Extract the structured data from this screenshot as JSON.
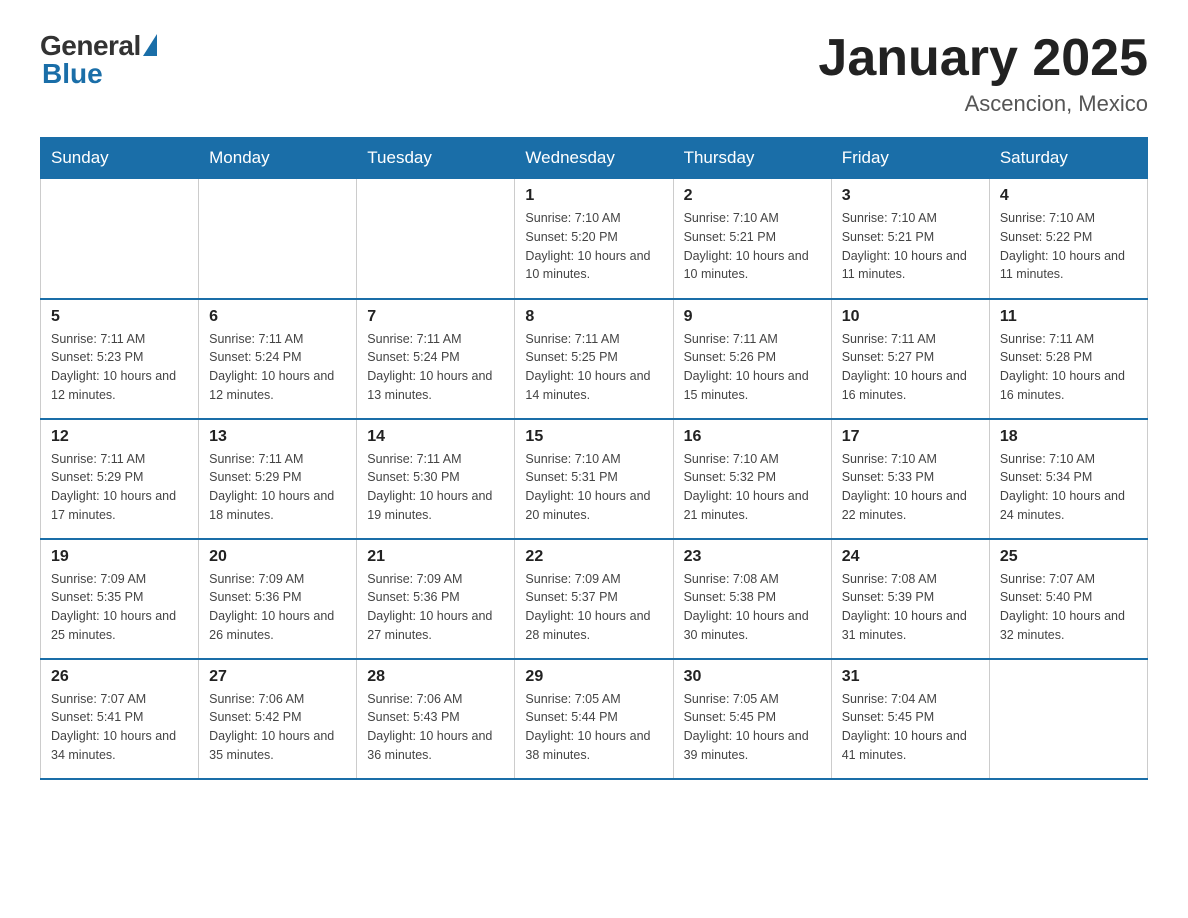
{
  "header": {
    "logo_general": "General",
    "logo_blue": "Blue",
    "month_title": "January 2025",
    "location": "Ascencion, Mexico"
  },
  "days_of_week": [
    "Sunday",
    "Monday",
    "Tuesday",
    "Wednesday",
    "Thursday",
    "Friday",
    "Saturday"
  ],
  "weeks": [
    [
      {
        "day": "",
        "info": ""
      },
      {
        "day": "",
        "info": ""
      },
      {
        "day": "",
        "info": ""
      },
      {
        "day": "1",
        "info": "Sunrise: 7:10 AM\nSunset: 5:20 PM\nDaylight: 10 hours\nand 10 minutes."
      },
      {
        "day": "2",
        "info": "Sunrise: 7:10 AM\nSunset: 5:21 PM\nDaylight: 10 hours\nand 10 minutes."
      },
      {
        "day": "3",
        "info": "Sunrise: 7:10 AM\nSunset: 5:21 PM\nDaylight: 10 hours\nand 11 minutes."
      },
      {
        "day": "4",
        "info": "Sunrise: 7:10 AM\nSunset: 5:22 PM\nDaylight: 10 hours\nand 11 minutes."
      }
    ],
    [
      {
        "day": "5",
        "info": "Sunrise: 7:11 AM\nSunset: 5:23 PM\nDaylight: 10 hours\nand 12 minutes."
      },
      {
        "day": "6",
        "info": "Sunrise: 7:11 AM\nSunset: 5:24 PM\nDaylight: 10 hours\nand 12 minutes."
      },
      {
        "day": "7",
        "info": "Sunrise: 7:11 AM\nSunset: 5:24 PM\nDaylight: 10 hours\nand 13 minutes."
      },
      {
        "day": "8",
        "info": "Sunrise: 7:11 AM\nSunset: 5:25 PM\nDaylight: 10 hours\nand 14 minutes."
      },
      {
        "day": "9",
        "info": "Sunrise: 7:11 AM\nSunset: 5:26 PM\nDaylight: 10 hours\nand 15 minutes."
      },
      {
        "day": "10",
        "info": "Sunrise: 7:11 AM\nSunset: 5:27 PM\nDaylight: 10 hours\nand 16 minutes."
      },
      {
        "day": "11",
        "info": "Sunrise: 7:11 AM\nSunset: 5:28 PM\nDaylight: 10 hours\nand 16 minutes."
      }
    ],
    [
      {
        "day": "12",
        "info": "Sunrise: 7:11 AM\nSunset: 5:29 PM\nDaylight: 10 hours\nand 17 minutes."
      },
      {
        "day": "13",
        "info": "Sunrise: 7:11 AM\nSunset: 5:29 PM\nDaylight: 10 hours\nand 18 minutes."
      },
      {
        "day": "14",
        "info": "Sunrise: 7:11 AM\nSunset: 5:30 PM\nDaylight: 10 hours\nand 19 minutes."
      },
      {
        "day": "15",
        "info": "Sunrise: 7:10 AM\nSunset: 5:31 PM\nDaylight: 10 hours\nand 20 minutes."
      },
      {
        "day": "16",
        "info": "Sunrise: 7:10 AM\nSunset: 5:32 PM\nDaylight: 10 hours\nand 21 minutes."
      },
      {
        "day": "17",
        "info": "Sunrise: 7:10 AM\nSunset: 5:33 PM\nDaylight: 10 hours\nand 22 minutes."
      },
      {
        "day": "18",
        "info": "Sunrise: 7:10 AM\nSunset: 5:34 PM\nDaylight: 10 hours\nand 24 minutes."
      }
    ],
    [
      {
        "day": "19",
        "info": "Sunrise: 7:09 AM\nSunset: 5:35 PM\nDaylight: 10 hours\nand 25 minutes."
      },
      {
        "day": "20",
        "info": "Sunrise: 7:09 AM\nSunset: 5:36 PM\nDaylight: 10 hours\nand 26 minutes."
      },
      {
        "day": "21",
        "info": "Sunrise: 7:09 AM\nSunset: 5:36 PM\nDaylight: 10 hours\nand 27 minutes."
      },
      {
        "day": "22",
        "info": "Sunrise: 7:09 AM\nSunset: 5:37 PM\nDaylight: 10 hours\nand 28 minutes."
      },
      {
        "day": "23",
        "info": "Sunrise: 7:08 AM\nSunset: 5:38 PM\nDaylight: 10 hours\nand 30 minutes."
      },
      {
        "day": "24",
        "info": "Sunrise: 7:08 AM\nSunset: 5:39 PM\nDaylight: 10 hours\nand 31 minutes."
      },
      {
        "day": "25",
        "info": "Sunrise: 7:07 AM\nSunset: 5:40 PM\nDaylight: 10 hours\nand 32 minutes."
      }
    ],
    [
      {
        "day": "26",
        "info": "Sunrise: 7:07 AM\nSunset: 5:41 PM\nDaylight: 10 hours\nand 34 minutes."
      },
      {
        "day": "27",
        "info": "Sunrise: 7:06 AM\nSunset: 5:42 PM\nDaylight: 10 hours\nand 35 minutes."
      },
      {
        "day": "28",
        "info": "Sunrise: 7:06 AM\nSunset: 5:43 PM\nDaylight: 10 hours\nand 36 minutes."
      },
      {
        "day": "29",
        "info": "Sunrise: 7:05 AM\nSunset: 5:44 PM\nDaylight: 10 hours\nand 38 minutes."
      },
      {
        "day": "30",
        "info": "Sunrise: 7:05 AM\nSunset: 5:45 PM\nDaylight: 10 hours\nand 39 minutes."
      },
      {
        "day": "31",
        "info": "Sunrise: 7:04 AM\nSunset: 5:45 PM\nDaylight: 10 hours\nand 41 minutes."
      },
      {
        "day": "",
        "info": ""
      }
    ]
  ]
}
